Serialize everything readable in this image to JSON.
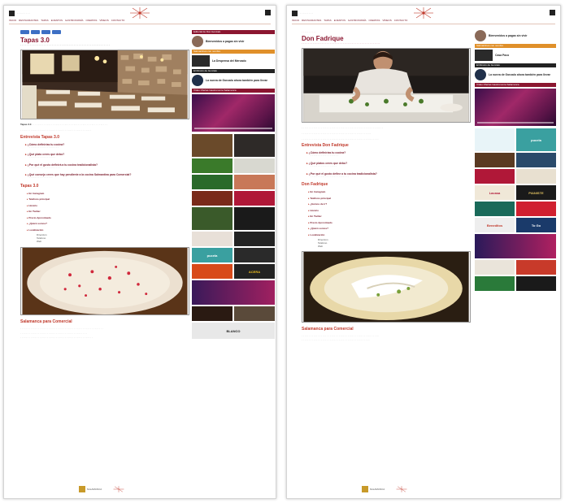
{
  "left": {
    "title": "Tapas 3.0",
    "section_interview": "Entrevista Tapas 3.0",
    "questions": [
      "¿Cómo definirías tu cocina?",
      "¿Qué plato crees que debo?",
      "¿Por qué el gusto definirá a tu cocina tradicionalista?",
      "¿Qué consejo crees que hay pendiente a la cocina Salmantina para Comercial?"
    ],
    "section_info": "Tapas 3.0",
    "info_items": [
      "En Instagram",
      "Telefono principal",
      "Horario",
      "En Twitter",
      "Precio Aproximado",
      "¿Quién somos?",
      "Localización"
    ],
    "addr_rows": [
      "Dirección",
      "Teléfono",
      "Web"
    ],
    "section_bottom": "Salamanca para Comercial",
    "images": [
      "restaurant interior photo",
      "risotto dish photo"
    ]
  },
  "right": {
    "title": "Don Fadrique",
    "section_interview": "Entrevista Don Fadrique",
    "questions": [
      "¿Cómo definirías tu cocina?",
      "¿Qué platos crees que debo?",
      "¿Por qué el gusto define a tu cocina tradicionalista?"
    ],
    "section_info": "Don Fadrique",
    "info_items": [
      "En Instagram",
      "Teléfono principal",
      "¿Hemos de ir?",
      "Horario",
      "En Twitter",
      "Precio Aproximado",
      "¿Quién somos?",
      "Localización"
    ],
    "addr_rows": [
      "Dirección",
      "Teléfono",
      "Web"
    ],
    "section_bottom": "Salamanca para Comercial",
    "images": [
      "chef plating photo",
      "fish dish photo"
    ]
  },
  "sidebar": {
    "left": {
      "sec1": "Editorial de Don Gonzalo",
      "item1": "Bienvenidos a pagas sin vivir",
      "sec2": "Salmantinos con nombre",
      "item2": "La Despensa del Mercado",
      "sec3": "El Rincón de Gonzalo",
      "item3": "La nueva de Gonzalo ahora también para llevar",
      "sec4": "Vídeo Ofertas Gastronomía Salamanca"
    },
    "right": {
      "item1": "Bienvenidos a pagas sin vivir",
      "sec2": "Salmantinos con nombre",
      "item2": "Casa Paco",
      "sec3": "El Rincón de Gonzalo",
      "item3": "La nueva de Gonzalo ahora también para llevar",
      "sec4": "Vídeo Ofertas Gastronomía Salamanca"
    },
    "ads_left": [
      "pucela",
      "ACERA",
      "BLANCO"
    ],
    "ads_right": [
      "pucela",
      "Lacasa",
      "PIANISTE",
      "Beneditos",
      "To Go"
    ]
  },
  "footer": {
    "logo1": "SALAMANCA"
  }
}
